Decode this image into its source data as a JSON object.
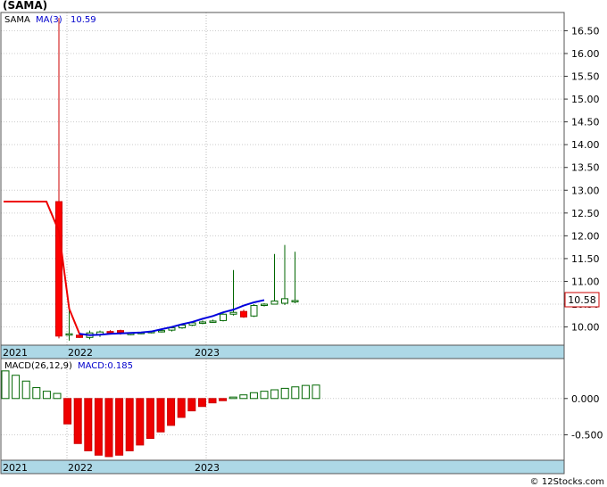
{
  "header": {
    "symbol": "(SAMA)"
  },
  "footer": {
    "credit": "© 12Stocks.com"
  },
  "chart_data": [
    {
      "type": "candlestick",
      "legend": {
        "symbol": "SAMA",
        "ma_label": "MA(3)",
        "ma_value": "10.59"
      },
      "last_price_tag": "10.58",
      "ylim": [
        9.6,
        16.9
      ],
      "yticks": [
        10.0,
        10.5,
        11.0,
        11.5,
        12.0,
        12.5,
        13.0,
        13.5,
        14.0,
        14.5,
        15.0,
        15.5,
        16.0,
        16.5
      ],
      "xlabels": [
        "2021",
        "2022",
        "2023"
      ],
      "grid": true,
      "candles": [
        {
          "o": 12.75,
          "h": 16.78,
          "l": 9.75,
          "c": 9.8
        },
        {
          "o": 9.85,
          "h": 10.5,
          "l": 9.7,
          "c": 9.85
        },
        {
          "o": 9.82,
          "h": 9.86,
          "l": 9.76,
          "c": 9.77
        },
        {
          "o": 9.77,
          "h": 9.92,
          "l": 9.73,
          "c": 9.87
        },
        {
          "o": 9.83,
          "h": 9.92,
          "l": 9.78,
          "c": 9.89
        },
        {
          "o": 9.9,
          "h": 9.93,
          "l": 9.86,
          "c": 9.87
        },
        {
          "o": 9.92,
          "h": 9.94,
          "l": 9.83,
          "c": 9.88
        },
        {
          "o": 9.85,
          "h": 9.88,
          "l": 9.82,
          "c": 9.86
        },
        {
          "o": 9.86,
          "h": 9.89,
          "l": 9.84,
          "c": 9.88
        },
        {
          "o": 9.88,
          "h": 9.91,
          "l": 9.86,
          "c": 9.9
        },
        {
          "o": 9.9,
          "h": 9.95,
          "l": 9.88,
          "c": 9.92
        },
        {
          "o": 9.93,
          "h": 10.0,
          "l": 9.9,
          "c": 9.98
        },
        {
          "o": 9.98,
          "h": 10.06,
          "l": 9.96,
          "c": 10.04
        },
        {
          "o": 10.04,
          "h": 10.11,
          "l": 10.02,
          "c": 10.09
        },
        {
          "o": 10.09,
          "h": 10.14,
          "l": 10.06,
          "c": 10.11
        },
        {
          "o": 10.12,
          "h": 10.16,
          "l": 10.09,
          "c": 10.13
        },
        {
          "o": 10.14,
          "h": 10.3,
          "l": 10.12,
          "c": 10.28
        },
        {
          "o": 10.28,
          "h": 11.25,
          "l": 10.25,
          "c": 10.32
        },
        {
          "o": 10.34,
          "h": 10.38,
          "l": 10.2,
          "c": 10.22
        },
        {
          "o": 10.24,
          "h": 10.5,
          "l": 10.22,
          "c": 10.47
        },
        {
          "o": 10.48,
          "h": 10.52,
          "l": 10.45,
          "c": 10.5
        },
        {
          "o": 10.5,
          "h": 11.6,
          "l": 10.5,
          "c": 10.57
        },
        {
          "o": 10.52,
          "h": 11.8,
          "l": 10.48,
          "c": 10.62
        },
        {
          "o": 10.55,
          "h": 11.65,
          "l": 10.52,
          "c": 10.58
        }
      ],
      "ma": [
        12.75,
        12.75,
        12.75,
        12.75,
        12.1,
        10.4,
        9.85,
        9.82,
        9.83,
        9.85,
        9.86,
        9.87,
        9.88,
        9.9,
        9.95,
        10.0,
        10.06,
        10.11,
        10.18,
        10.24,
        10.32,
        10.38,
        10.47,
        10.54,
        10.59
      ]
    },
    {
      "type": "bar",
      "legend": {
        "label": "MACD(26,12,9)",
        "value_label": "MACD:0.185"
      },
      "ylim": [
        -0.85,
        0.55
      ],
      "yticks": [
        0.0,
        -0.5
      ],
      "ytick_labels": [
        "0.000",
        "-0.500"
      ],
      "xlabels": [
        "2021",
        "2022",
        "2023"
      ],
      "values": [
        0.38,
        0.32,
        0.24,
        0.15,
        0.1,
        0.07,
        -0.35,
        -0.62,
        -0.72,
        -0.78,
        -0.8,
        -0.78,
        -0.72,
        -0.64,
        -0.55,
        -0.46,
        -0.37,
        -0.26,
        -0.17,
        -0.11,
        -0.06,
        -0.03,
        0.02,
        0.05,
        0.08,
        0.1,
        0.12,
        0.14,
        0.16,
        0.18,
        0.185
      ]
    }
  ]
}
